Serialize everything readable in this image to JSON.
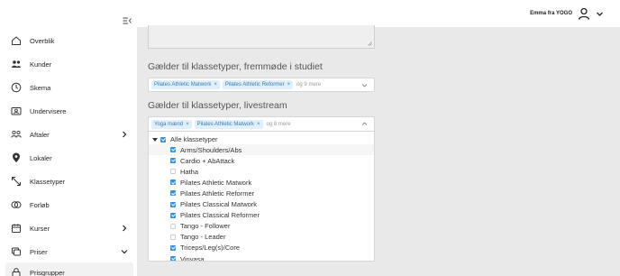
{
  "header": {
    "user_name": "Emma fra YOGO"
  },
  "sidebar": {
    "items": [
      {
        "label": "Overblik",
        "icon": "home-icon"
      },
      {
        "label": "Kunder",
        "icon": "users-icon"
      },
      {
        "label": "Skema",
        "icon": "clock-icon"
      },
      {
        "label": "Undervisere",
        "icon": "id-card-icon"
      },
      {
        "label": "Aftaler",
        "icon": "people-icon",
        "has_arrow": true
      },
      {
        "label": "Lokaler",
        "icon": "location-pin-icon"
      },
      {
        "label": "Klassetyper",
        "icon": "arrows-icon"
      },
      {
        "label": "Forløb",
        "icon": "rings-icon"
      },
      {
        "label": "Kurser",
        "icon": "calendar-icon",
        "has_arrow": true
      },
      {
        "label": "Priser",
        "icon": "price-tag-icon",
        "has_arrow": true
      },
      {
        "label": "Prisgrupper",
        "icon": "lock-icon"
      }
    ]
  },
  "studio_section": {
    "title": "Gælder til klassetyper, fremmøde i studiet",
    "chips": [
      "Pilates Athletic Matwork",
      "Pilates Athletic Reformer"
    ],
    "more": "og 9 mere"
  },
  "livestream_section": {
    "title": "Gælder til klassetyper, livestream",
    "chips": [
      "Yoga mænd",
      "Pilates Athletic Matwork"
    ],
    "more": "og 8 mere"
  },
  "tree": {
    "root_label": "Alle klassetyper",
    "items": [
      {
        "label": "Arms/Shoulders/Abs",
        "checked": true
      },
      {
        "label": "Cardio + AbAttack",
        "checked": true
      },
      {
        "label": "Hatha",
        "checked": false
      },
      {
        "label": "Pilates Athletic Matwork",
        "checked": true
      },
      {
        "label": "Pilates Athletic Reformer",
        "checked": true
      },
      {
        "label": "Pilates Classical Matwork",
        "checked": true
      },
      {
        "label": "Pilates Classical Reformer",
        "checked": true
      },
      {
        "label": "Tango - Follower",
        "checked": false
      },
      {
        "label": "Tango - Leader",
        "checked": false
      },
      {
        "label": "Triceps/Leg(s)/Core",
        "checked": true
      },
      {
        "label": "Vinyasa",
        "checked": true
      }
    ]
  },
  "colors": {
    "accent": "#3a8fd6",
    "chip_bg": "#dff0fb",
    "main_bg": "#e9e9e9"
  }
}
